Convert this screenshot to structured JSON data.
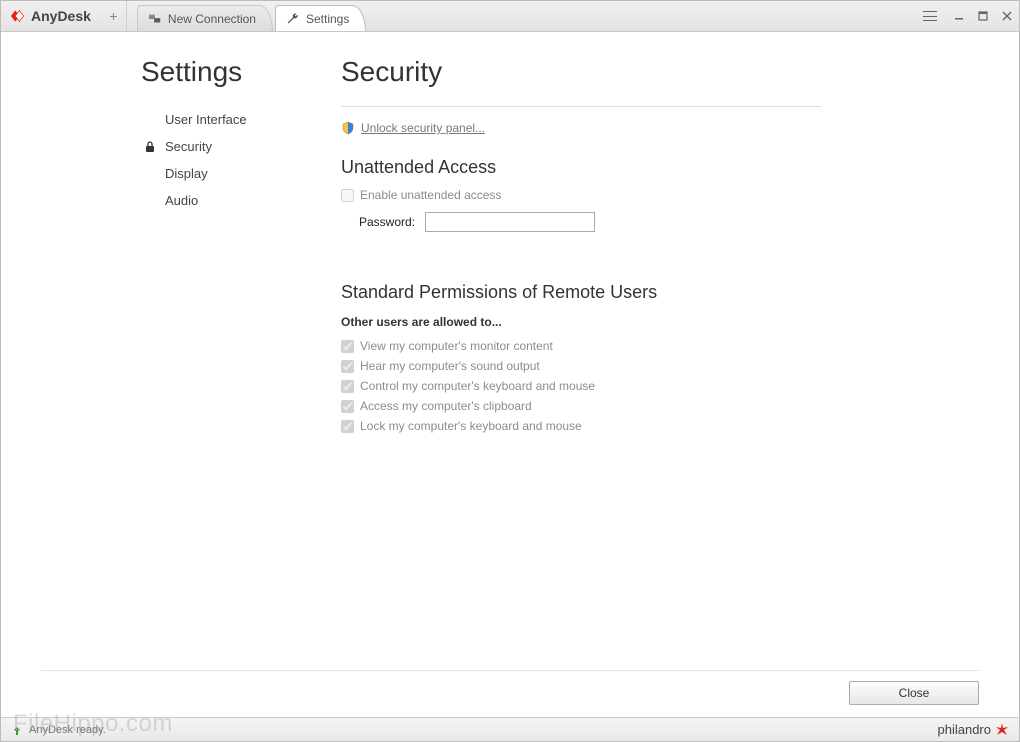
{
  "app": {
    "name": "AnyDesk"
  },
  "titlebar": {
    "tabs": [
      {
        "label": "New Connection"
      },
      {
        "label": "Settings"
      }
    ],
    "new_tab_glyph": "+"
  },
  "sidebar": {
    "title": "Settings",
    "items": [
      {
        "label": "User Interface"
      },
      {
        "label": "Security"
      },
      {
        "label": "Display"
      },
      {
        "label": "Audio"
      }
    ]
  },
  "page": {
    "title": "Security",
    "unlock_label": "Unlock security panel...",
    "unattended": {
      "title": "Unattended Access",
      "enable_label": "Enable unattended access",
      "password_label": "Password:",
      "password_value": ""
    },
    "permissions": {
      "title": "Standard Permissions of Remote Users",
      "subtitle": "Other users are allowed to...",
      "items": [
        {
          "label": "View my computer's monitor content"
        },
        {
          "label": "Hear my computer's sound output"
        },
        {
          "label": "Control my computer's keyboard and mouse"
        },
        {
          "label": "Access my computer's clipboard"
        },
        {
          "label": "Lock my computer's keyboard and mouse"
        }
      ]
    },
    "close_label": "Close"
  },
  "status": {
    "text": "AnyDesk ready.",
    "brand": "philandro",
    "watermark": "FileHippo.com"
  }
}
